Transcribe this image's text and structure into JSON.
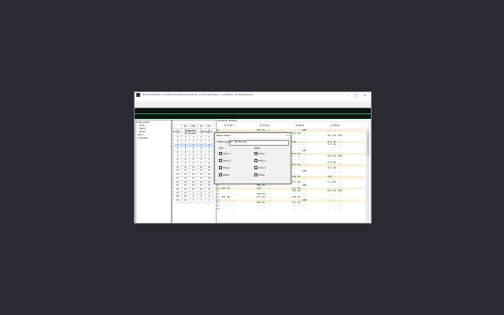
{
  "window": {
    "title": "0CC-FamiTracker - Untitled Pumped Ascending - 4x Slot Synthesis - [Untitled] - (0 Tab Opened)",
    "controls": [
      "–",
      "□",
      "×"
    ]
  },
  "menu": [
    "File",
    "Edit",
    "Help"
  ],
  "toolbar": {
    "buttons": [
      "Execute...",
      "Start",
      "Create",
      "Stop",
      "Export SID",
      "Export .NSFe",
      "Monitor Group",
      "Stereo"
    ],
    "instrument_label": "Instrument:",
    "instrument_value": "(no instrument)",
    "volume_label": "Volume:",
    "volume_value": "4",
    "step_label": "Step:",
    "step_value": "0"
  },
  "tree": [
    "Instruments",
    "Duty",
    "Wave",
    "Noise",
    "Pitch",
    "Envelope"
  ],
  "mid_tabs": [
    "Sounds",
    "Patterns",
    "Instruments",
    "Waves"
  ],
  "seq": {
    "headers": [
      "Sel",
      "Duty",
      "Vol",
      "Pan"
    ],
    "rows": [
      [
        "0",
        "0",
        "1",
        "0",
        "0"
      ],
      [
        "1",
        "1",
        "1",
        "0",
        "0"
      ],
      [
        "2",
        "2",
        "2",
        "2",
        "2"
      ],
      [
        "3",
        "3",
        "3",
        "3",
        "3"
      ],
      [
        "4",
        "4",
        "4",
        "4",
        "4"
      ],
      [
        "5",
        "5",
        "5",
        "5",
        "5"
      ],
      [
        "6",
        "6",
        "6",
        "6",
        "6"
      ],
      [
        "7",
        "7",
        "7",
        "7",
        "7"
      ],
      [
        "8",
        "8",
        "8",
        "8",
        "8"
      ],
      [
        "9",
        "9",
        "9",
        "9",
        "9"
      ],
      [
        "10",
        "10",
        "10",
        "10",
        "10"
      ],
      [
        "11",
        "11",
        "11",
        "11",
        "11"
      ],
      [
        "12",
        "12",
        "12",
        "12",
        "12"
      ],
      [
        "13",
        "13",
        "13",
        "13",
        "13"
      ],
      [
        "14",
        "14",
        "14",
        "14",
        "14"
      ],
      [
        "15",
        "15",
        "15",
        "15",
        "15"
      ],
      [
        "16",
        "16",
        "16",
        "16",
        "16"
      ],
      [
        "17",
        "17",
        "2",
        "2",
        "2"
      ],
      [
        "18",
        "18",
        "0",
        "0",
        "0"
      ],
      [
        "19",
        "19",
        "1",
        "1",
        "1"
      ]
    ]
  },
  "channel_tabs": [
    "Comments",
    "Positions"
  ],
  "channels": [
    "Duty 1",
    "Duty 2",
    "Noise",
    "Noise"
  ],
  "pattern_rows": [
    {
      "n": "00",
      "c": [
        "... .. ...",
        "F#4 01 ...",
        "... .. C#3",
        "... .. ..."
      ]
    },
    {
      "n": "01",
      "c": [
        "... .. ...",
        "... .. ...",
        "B-3 01 ...",
        "... .. ..."
      ]
    },
    {
      "n": "02",
      "c": [
        "... .. ...",
        "F#4 01 C#3",
        "... .. ...",
        "B-4 01 C#3"
      ]
    },
    {
      "n": "03",
      "c": [
        "... .. ...",
        "... .. ...",
        "... .. ...",
        "... .. ..."
      ]
    },
    {
      "n": "04",
      "c": [
        "... .. ...",
        "F#4 01 ...",
        "C#3 .. ...",
        "B-4 01 ..."
      ]
    },
    {
      "n": "05",
      "c": [
        "... .. ...",
        "... .. ...",
        "... .. ...",
        "C-5 01 ..."
      ]
    },
    {
      "n": "06",
      "c": [
        "... .. ...",
        "... .. ...",
        "... .. ...",
        "... .. ..."
      ]
    },
    {
      "n": "07",
      "c": [
        "... .. ...",
        "... .. ...",
        "... .. C#3",
        "... .. ..."
      ]
    },
    {
      "n": "08",
      "c": [
        "... .. ...",
        "F#4 01 ...",
        "B-3 01 ...",
        "... .. ..."
      ]
    },
    {
      "n": "09",
      "c": [
        "... .. ...",
        "... .. ...",
        "... .. ...",
        "B-4 01 C#3"
      ]
    },
    {
      "n": "0A",
      "c": [
        "... .. ...",
        "... .. ...",
        "... .. ...",
        "... .. ..."
      ]
    },
    {
      "n": "0B",
      "c": [
        "... .. ...",
        "F#4 01 C#3",
        "... .. ...",
        "E-5 01 ..."
      ]
    },
    {
      "n": "0C",
      "c": [
        "... .. ...",
        "... .. ...",
        "B-3 01 ...",
        "... .. ..."
      ]
    },
    {
      "n": "0D",
      "c": [
        "... .. ...",
        "F#4 01 ...",
        "... .. ...",
        "B-4 01 ..."
      ]
    },
    {
      "n": "0E",
      "c": [
        "... .. ...",
        "... .. ...",
        "... .. C#3",
        "... .. ..."
      ]
    },
    {
      "n": "0F",
      "c": [
        "... .. ...",
        "... .. ...",
        "... .. ...",
        "... .. ..."
      ]
    },
    {
      "n": "10",
      "c": [
        "A#5 05",
        "B-4 01 ...",
        "F#4 01 ...",
        "C#3 .. ..."
      ]
    },
    {
      "n": "11",
      "c": [
        "... .. ...",
        "... .. ...",
        "... .. ...",
        "... .. ..."
      ]
    },
    {
      "n": "12",
      "c": [
        "F#4 05",
        "... .. ...",
        "B-4 01 ...",
        "C-5 01 ..."
      ]
    },
    {
      "n": "13",
      "c": [
        "... .. ...",
        "F#4 01 ...",
        "... .. C#3",
        "... .. ..."
      ]
    },
    {
      "n": "14",
      "c": [
        "F#4 05",
        "C#3 .. ...",
        "B-4 01 ...",
        "... .. ..."
      ]
    },
    {
      "n": "15",
      "c": [
        "... .. ...",
        "... .. ...",
        "F#4 01 ...",
        "B-4 01 C#3"
      ]
    },
    {
      "n": "16",
      "c": [
        "... .. ...",
        "F#4 01 ...",
        "... .. ...",
        "... .. ..."
      ]
    },
    {
      "n": "17",
      "c": [
        "Ent 05",
        "E-4 01 ...",
        "F#3 01 ...",
        "... .. ..."
      ]
    },
    {
      "n": "18",
      "c": [
        "... .. ...",
        "... .. ...",
        "... .. C#3",
        "... .. ..."
      ]
    },
    {
      "n": "19",
      "c": [
        "... .. ...",
        "F#4 01 ...",
        "B-4 01 ...",
        "... .. ..."
      ]
    },
    {
      "n": "1A",
      "c": [
        "... .. ...",
        "... .. ...",
        "... .. ...",
        "... .. ..."
      ]
    },
    {
      "n": "1B",
      "c": [
        "... .. ...",
        "... .. ...",
        "... .. ...",
        "... .. ..."
      ]
    }
  ],
  "dialog": {
    "title": "Effect Editor",
    "close": "×",
    "type_label": "Effect type:",
    "type_value": "Sx - Set Panning",
    "left_label": "Left",
    "right_label": "Right",
    "left_items": [
      "Duty 1",
      "Duty 2",
      "Noise",
      "Noise"
    ],
    "right_items": [
      "Duty 1",
      "Duty 2",
      "Duty 2",
      "Noise"
    ],
    "left_checked": [
      true,
      true,
      true,
      true
    ],
    "right_checked": [
      true,
      true,
      false,
      false
    ]
  }
}
